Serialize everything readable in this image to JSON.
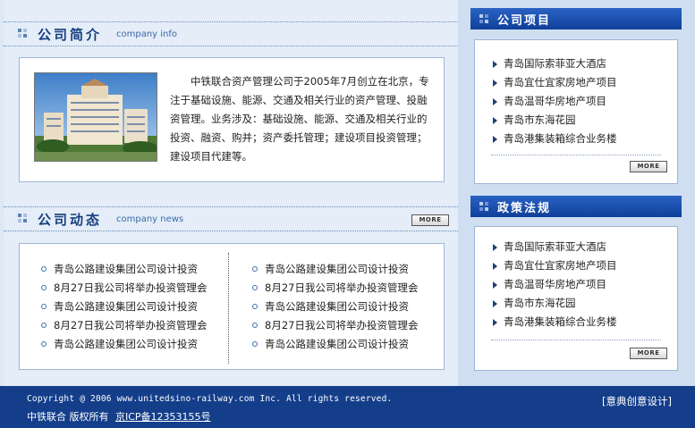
{
  "company_info": {
    "title_cn": "公司简介",
    "title_en": "company info",
    "text": "中铁联合资产管理公司于2005年7月创立在北京，专注于基础设施、能源、交通及相关行业的资产管理、投融资管理。业务涉及：基础设施、能源、交通及相关行业的投资、融资、购并；资产委托管理；建设项目投资管理；建设项目代建等。"
  },
  "company_news": {
    "title_cn": "公司动态",
    "title_en": "company news",
    "more_label": "MORE",
    "left_items": [
      "青岛公路建设集团公司设计投资",
      "8月27日我公司将举办投资管理会",
      "青岛公路建设集团公司设计投资",
      "8月27日我公司将举办投资管理会",
      "青岛公路建设集团公司设计投资"
    ],
    "right_items": [
      "青岛公路建设集团公司设计投资",
      "8月27日我公司将举办投资管理会",
      "青岛公路建设集团公司设计投资",
      "8月27日我公司将举办投资管理会",
      "青岛公路建设集团公司设计投资"
    ]
  },
  "projects": {
    "title": "公司项目",
    "more_label": "MORE",
    "items": [
      "青岛国际索菲亚大酒店",
      "青岛宜仕宜家房地产项目",
      "青岛温哥华房地产项目",
      "青岛市东海花园",
      "青岛港集装箱综合业务楼"
    ]
  },
  "policies": {
    "title": "政策法规",
    "more_label": "MORE",
    "items": [
      "青岛国际索菲亚大酒店",
      "青岛宜仕宜家房地产项目",
      "青岛温哥华房地产项目",
      "青岛市东海花园",
      "青岛港集装箱综合业务楼"
    ]
  },
  "footer": {
    "copyright": "Copyright @ 2006 www.unitedsino-railway.com Inc. All rights reserved.",
    "owner": "中铁联合 版权所有",
    "icp": "京ICP备12353155号",
    "designer": "[意典创意设计]"
  },
  "colors": {
    "accent": "#143e8a",
    "heading": "#163f7e",
    "background": "#dce8f6"
  }
}
